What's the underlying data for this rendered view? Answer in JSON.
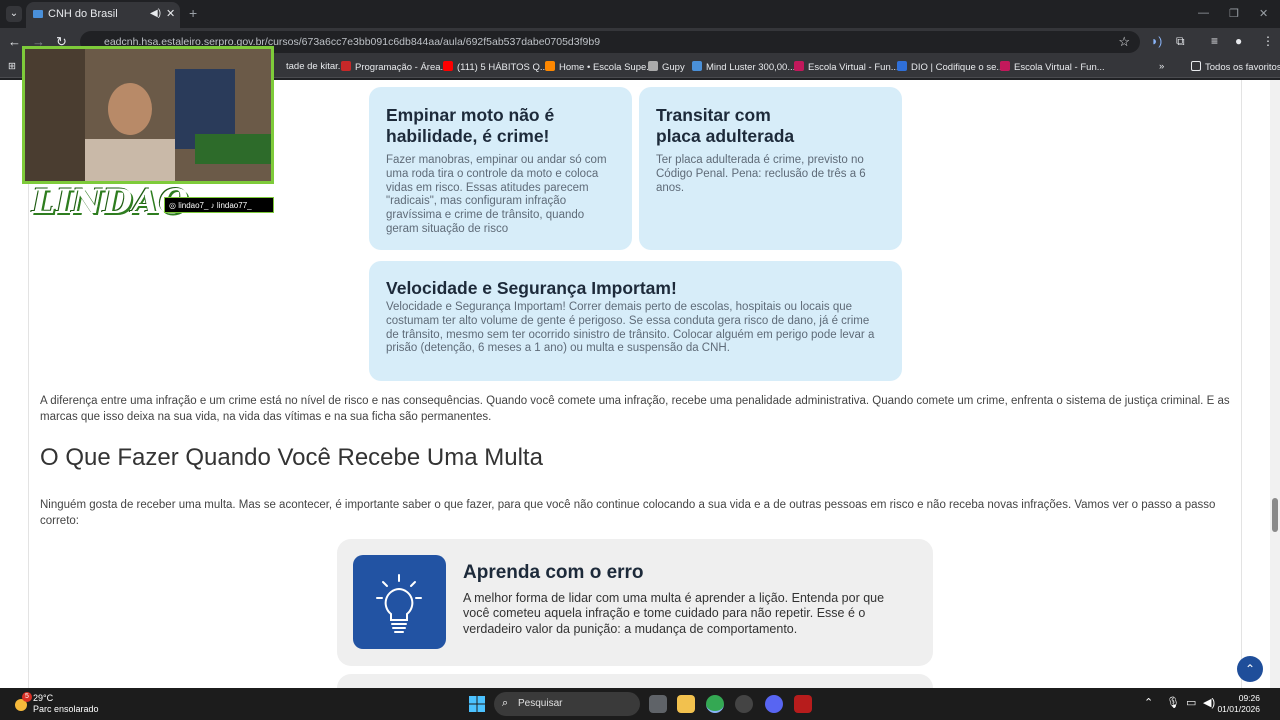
{
  "browser": {
    "tab_title": "CNH do Brasil",
    "url": "eadcnh.hsa.estaleiro.serpro.gov.br/cursos/673a6cc7e3bb091c6db844aa/aula/692f5ab537dabe0705d3f9b9",
    "bookmarks": [
      "tade de kitar...",
      "Programação - Área...",
      "(111) 5 HÁBITOS Q...",
      "Home • Escola Supe...",
      "Gupy",
      "Mind Luster 300,00...",
      "Escola Virtual - Fun...",
      "DIO | Codifique o se...",
      "Escola Virtual - Fun..."
    ],
    "all_bookmarks": "Todos os favoritos"
  },
  "overlay": {
    "logo": "LINDAO",
    "handles": "◎ lindao7_   ♪ lindao77_"
  },
  "cards": [
    {
      "title": "Empinar moto não é habilidade, é crime!",
      "text": "Fazer manobras, empinar ou andar só com uma roda tira o controle da moto e coloca vidas em risco. Essas atitudes parecem \"radicais\", mas configuram infração gravíssima e crime de trânsito, quando geram situação de risco"
    },
    {
      "title": "Transitar com placa adulterada",
      "text": "Ter placa adulterada é crime, previsto no Código Penal. Pena: reclusão de três a 6 anos."
    },
    {
      "title": "Velocidade e Segurança Importam!",
      "text": "Velocidade e Segurança Importam! Correr demais perto de escolas, hospitais ou locais que costumam ter alto volume de gente é perigoso. Se essa conduta gera risco de dano, já é crime de trânsito, mesmo sem ter ocorrido sinistro de trânsito. Colocar alguém em perigo pode levar a prisão (detenção, 6 meses a 1 ano) ou multa e suspensão da CNH."
    }
  ],
  "content": {
    "paragraph1": "A diferença entre uma infração e um crime está no nível de risco e nas consequências. Quando você comete uma infração, recebe uma penalidade administrativa. Quando comete um crime, enfrenta o sistema de justiça criminal. E as marcas que isso deixa na sua vida, na vida das vítimas e na sua ficha são permanentes.",
    "heading": "O Que Fazer Quando Você Recebe Uma Multa",
    "paragraph2": "Ninguém gosta de receber uma multa. Mas se acontecer, é importante saber o que fazer, para que você não continue colocando a sua vida e a de outras pessoas em risco e não receba novas infrações. Vamos ver o passo a passo correto:",
    "step_title": "Aprenda com o erro",
    "step_text": "A melhor forma de lidar com uma multa é aprender a lição. Entenda por que você cometeu aquela infração e tome cuidado para não repetir. Esse é o verdadeiro valor da punição: a mudança de comportamento."
  },
  "taskbar": {
    "temp": "29°C",
    "weather": "Parc ensolarado",
    "weather_badge": "5",
    "search": "Pesquisar",
    "time": "09:26",
    "date": "01/01/2026"
  }
}
